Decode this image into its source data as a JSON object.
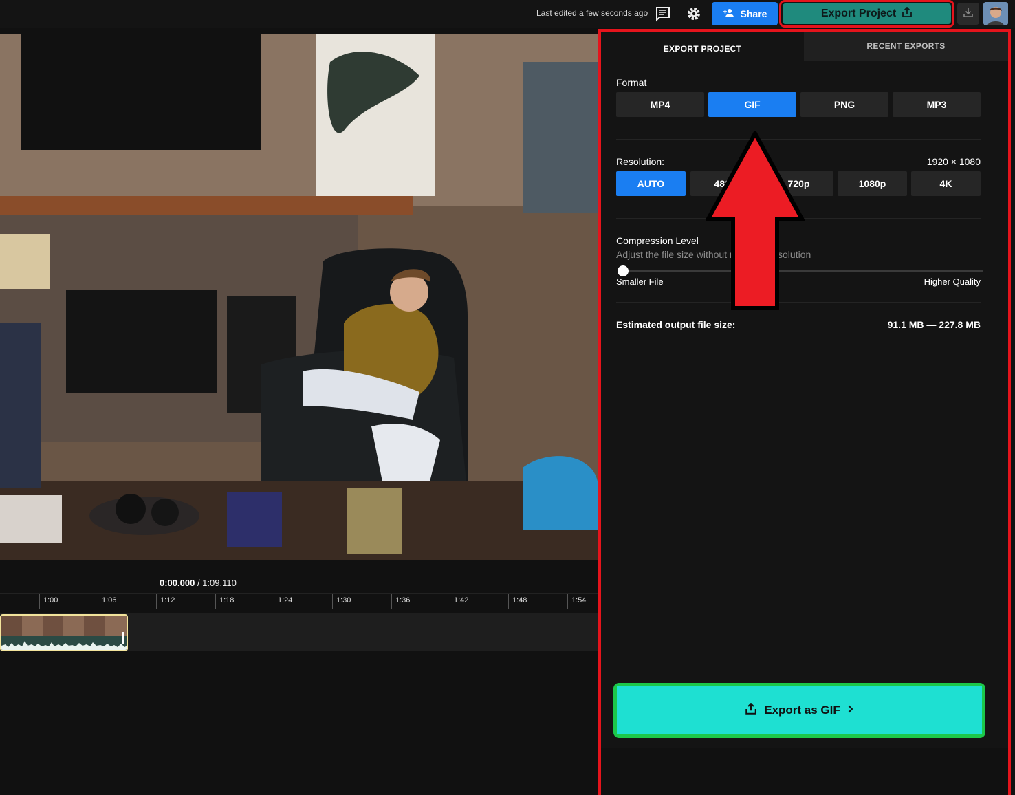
{
  "topbar": {
    "last_edited": "Last edited a few seconds ago",
    "share_label": "Share",
    "export_label": "Export Project"
  },
  "timeline": {
    "current_time": "0:00.000",
    "separator": " / ",
    "total_time": "1:09.110",
    "ticks": [
      "1:00",
      "1:06",
      "1:12",
      "1:18",
      "1:24",
      "1:30",
      "1:36",
      "1:42",
      "1:48",
      "1:54"
    ]
  },
  "export_panel": {
    "tab_export": "EXPORT PROJECT",
    "tab_recent": "RECENT EXPORTS",
    "format_label": "Format",
    "formats": [
      "MP4",
      "GIF",
      "PNG",
      "MP3"
    ],
    "selected_format": "GIF",
    "resolution_label": "Resolution:",
    "resolution_value": "1920 × 1080",
    "resolutions": [
      "AUTO",
      "480p",
      "720p",
      "1080p",
      "4K"
    ],
    "selected_resolution": "AUTO",
    "compression_label": "Compression Level",
    "compression_desc": "Adjust the file size without reducing resolution",
    "compression_level": 0,
    "slider_min_label": "Smaller File",
    "slider_max_label": "Higher Quality",
    "estimate_label": "Estimated output file size:",
    "estimate_value": "91.1 MB — 227.8 MB",
    "cta_label": "Export as GIF"
  },
  "colors": {
    "accent_blue": "#1a7ef2",
    "export_teal": "#1f8a7d",
    "cta_cyan": "#1ee0d2",
    "annotation_red": "#e5141c",
    "annotation_green": "#1cc84a"
  }
}
